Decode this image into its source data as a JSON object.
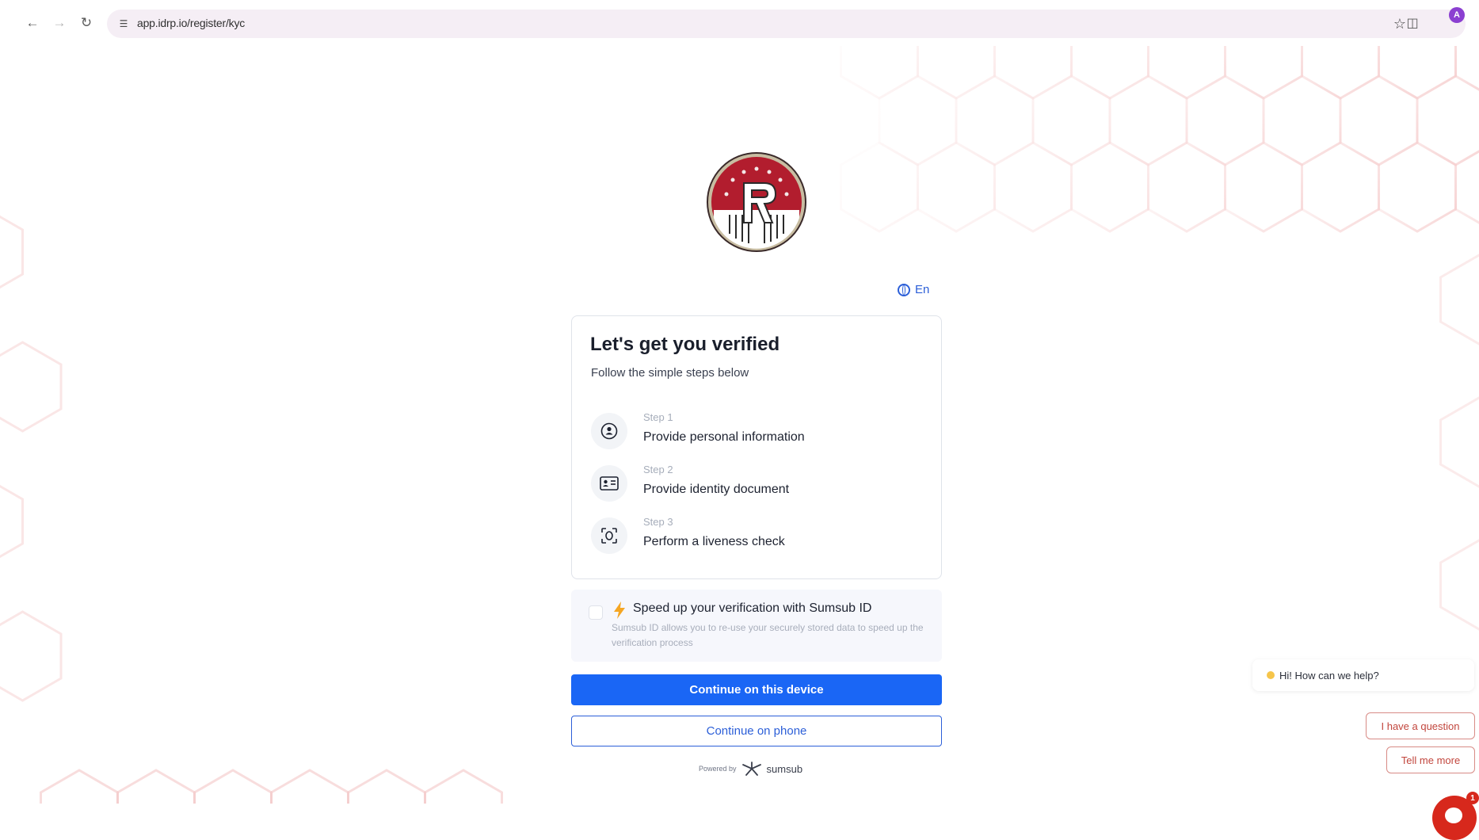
{
  "browser": {
    "url": "app.idrp.io/register/kyc",
    "profile_initial": "A",
    "icons": [
      "back-icon",
      "forward-icon",
      "reload-icon",
      "site-info-icon",
      "bookmark-star-icon",
      "extensions-icon",
      "profile-avatar"
    ]
  },
  "language": {
    "label": "En"
  },
  "card": {
    "title": "Let's get you verified",
    "subtitle": "Follow the simple steps below",
    "steps": [
      {
        "number": "Step 1",
        "label": "Provide personal information",
        "icon": "person-icon"
      },
      {
        "number": "Step 2",
        "label": "Provide identity document",
        "icon": "id-card-icon"
      },
      {
        "number": "Step 3",
        "label": "Perform a liveness check",
        "icon": "face-scan-icon"
      }
    ]
  },
  "sumsub": {
    "title": "Speed up your verification with Sumsub ID",
    "description": "Sumsub ID allows you to re-use your securely stored data to speed up the verification process",
    "checked": false
  },
  "buttons": {
    "continue_device": "Continue on this device",
    "continue_phone": "Continue on phone"
  },
  "footer": {
    "powered_by": "Powered by",
    "brand": "sumsub"
  },
  "chat": {
    "greeting": "Hi! How can we help?",
    "options": [
      "I have a question",
      "Tell me more"
    ],
    "badge": "1"
  },
  "colors": {
    "primary": "#1a66f5",
    "link": "#2c5fd8",
    "chat_accent": "#d7281c",
    "hex_pattern": "#f4c9c9"
  }
}
